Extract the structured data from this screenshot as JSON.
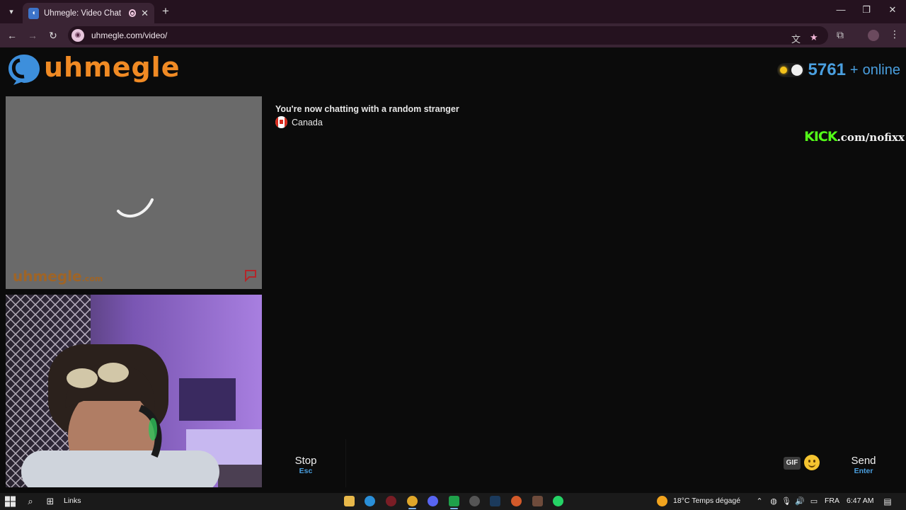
{
  "browser": {
    "tab_title": "Uhmegle: Video Chat | Ome",
    "url": "uhmegle.com/video/"
  },
  "site": {
    "logo_text": "uhmegle",
    "online_count": "5761",
    "online_plus": "+",
    "online_label": "online"
  },
  "stranger": {
    "watermark": "uhmegle",
    "watermark_suffix": ".com"
  },
  "chat": {
    "status_text": "You're now chatting with a random stranger",
    "country": "Canada",
    "overlay_kick": "KICK",
    "overlay_rest": ".com/nofixx"
  },
  "controls": {
    "stop_label": "Stop",
    "stop_key": "Esc",
    "send_label": "Send",
    "send_key": "Enter",
    "gif_label": "GIF",
    "message_value": ""
  },
  "taskbar": {
    "links_label": "Links",
    "weather": "18°C  Temps dégagé",
    "language": "FRA",
    "time": "6:47 AM"
  },
  "colors": {
    "accent_blue": "#4a9fdf",
    "logo_orange": "#f08a24",
    "kick_green": "#53fc18"
  }
}
